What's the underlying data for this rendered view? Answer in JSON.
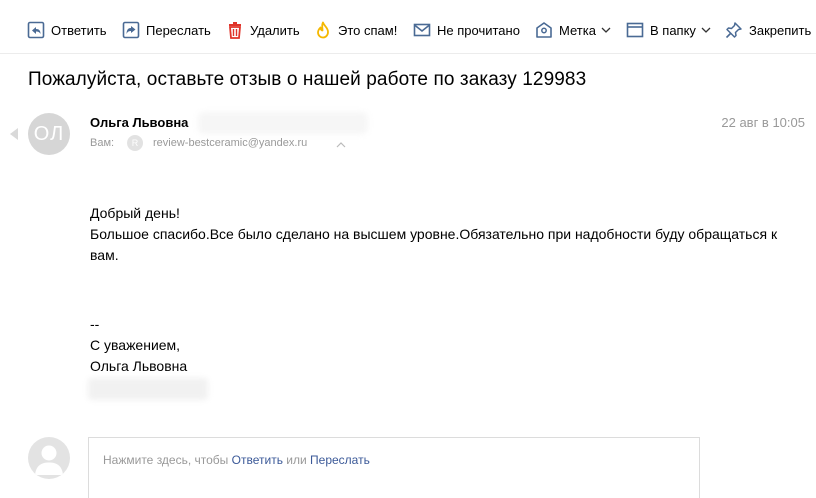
{
  "toolbar": {
    "reply": {
      "label": "Ответить",
      "icon": "reply-icon"
    },
    "forward": {
      "label": "Переслать",
      "icon": "forward-icon"
    },
    "delete": {
      "label": "Удалить",
      "icon": "trash-icon"
    },
    "spam": {
      "label": "Это спам!",
      "icon": "fire-icon"
    },
    "unread": {
      "label": "Не прочитано",
      "icon": "envelope-icon"
    },
    "label": {
      "label": "Метка",
      "icon": "tag-icon"
    },
    "folder": {
      "label": "В папку",
      "icon": "folder-icon"
    },
    "pin": {
      "label": "Закрепить",
      "icon": "pin-icon"
    }
  },
  "colors": {
    "accent": "#3b5998",
    "delete_red": "#e0342a",
    "spam_yellow": "#f5b800",
    "icon_blue": "#4a6a94",
    "muted_text": "#999999",
    "avatar_gray": "#d6d6d6"
  },
  "message": {
    "subject": "Пожалуйста, оставьте отзыв о нашей работе по заказу 129983",
    "sender_initials": "ОЛ",
    "sender_name": "Ольга Львовна",
    "to_label": "Вам:",
    "to_avatar_letter": "R",
    "to_email": "review-bestceramic@yandex.ru",
    "date": "22 авг в 10:05",
    "body_lines": [
      "Добрый день!",
      "Большое спасибо.Все было сделано на высшем уровне.Обязательно при надобности буду обращаться к вам."
    ],
    "signature_lines": [
      "--",
      "С уважением,",
      "Ольга Львовна"
    ]
  },
  "reply_box": {
    "prefix": "Нажмите здесь, чтобы ",
    "reply_link": "Ответить",
    "middle": " или ",
    "forward_link": "Переслать"
  }
}
